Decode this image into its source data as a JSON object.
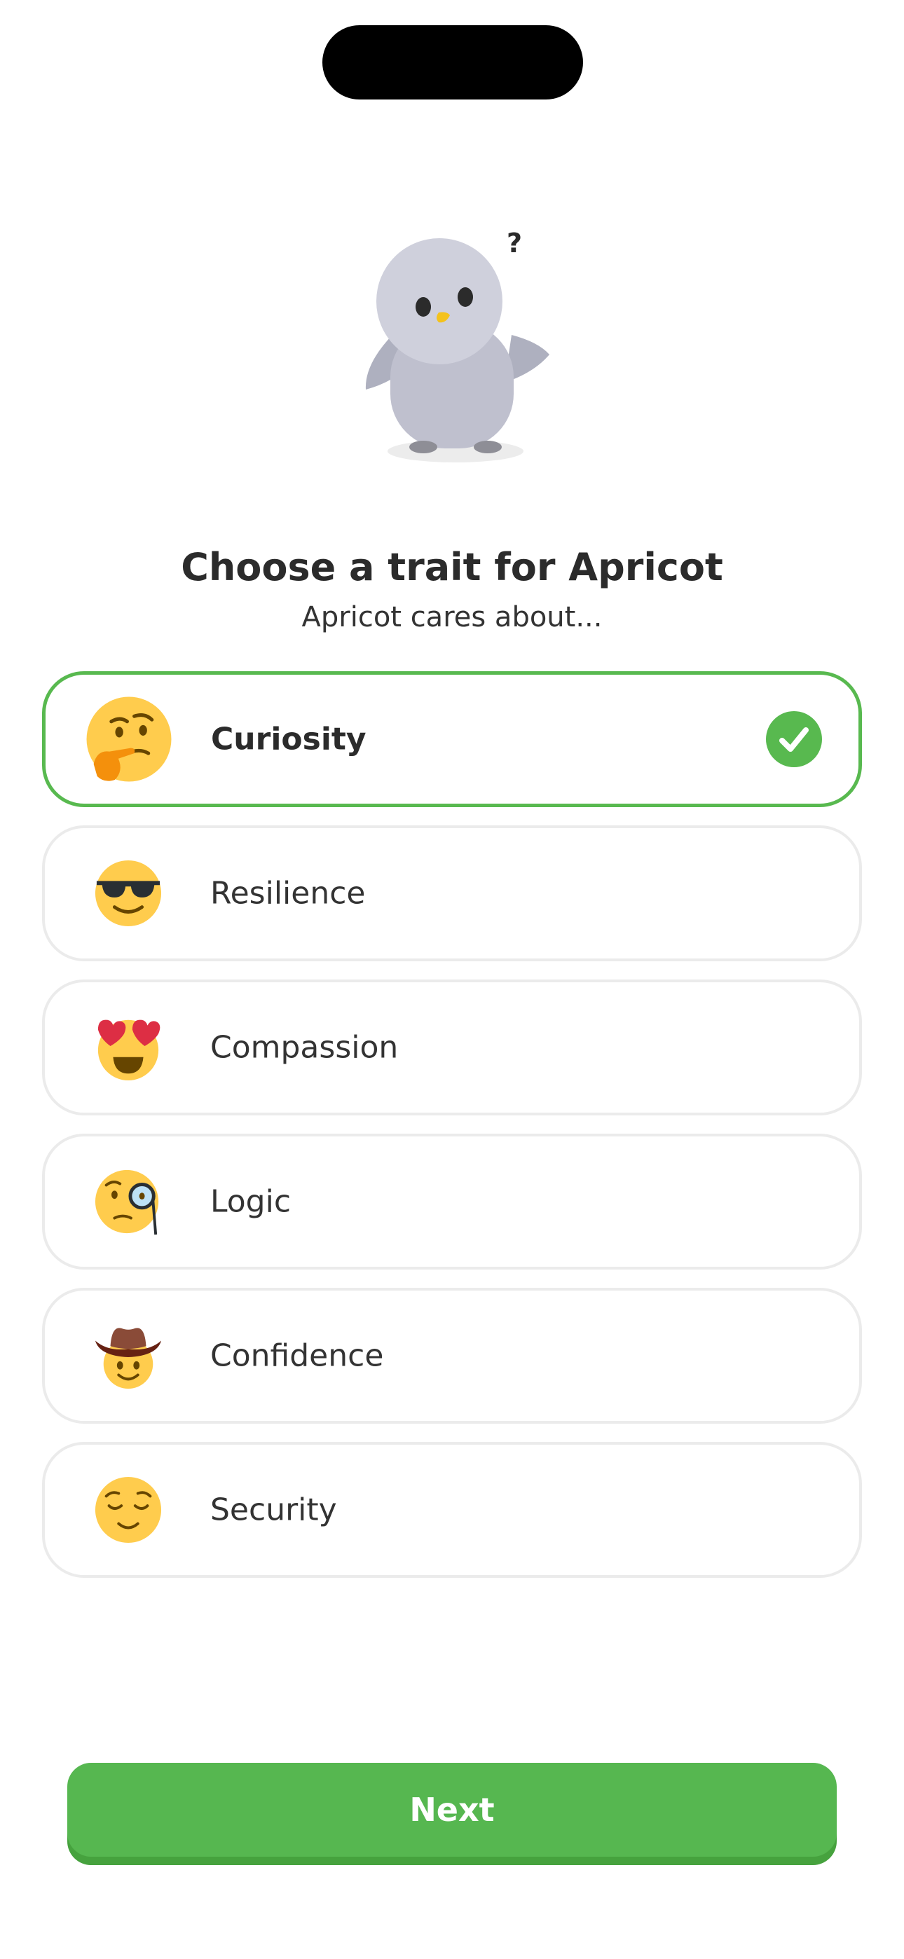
{
  "header": {
    "title": "Choose a trait for Apricot",
    "subtitle": "Apricot cares about..."
  },
  "mascot": {
    "icon": "bird-mascot-question",
    "thought_mark": "?"
  },
  "traits": [
    {
      "label": "Curiosity",
      "icon": "thinking-face-icon",
      "selected": true
    },
    {
      "label": "Resilience",
      "icon": "sunglasses-face-icon",
      "selected": false
    },
    {
      "label": "Compassion",
      "icon": "heart-eyes-face-icon",
      "selected": false
    },
    {
      "label": "Logic",
      "icon": "monocle-face-icon",
      "selected": false
    },
    {
      "label": "Confidence",
      "icon": "cowboy-face-icon",
      "selected": false
    },
    {
      "label": "Security",
      "icon": "relieved-face-icon",
      "selected": false
    }
  ],
  "footer": {
    "next_label": "Next"
  },
  "colors": {
    "accent": "#58b94f",
    "button": "#56b750",
    "button_shadow": "#46a23e",
    "card_border": "#ebebeb",
    "text": "#2b2b2b",
    "emoji_yellow": "#ffcc4d"
  }
}
